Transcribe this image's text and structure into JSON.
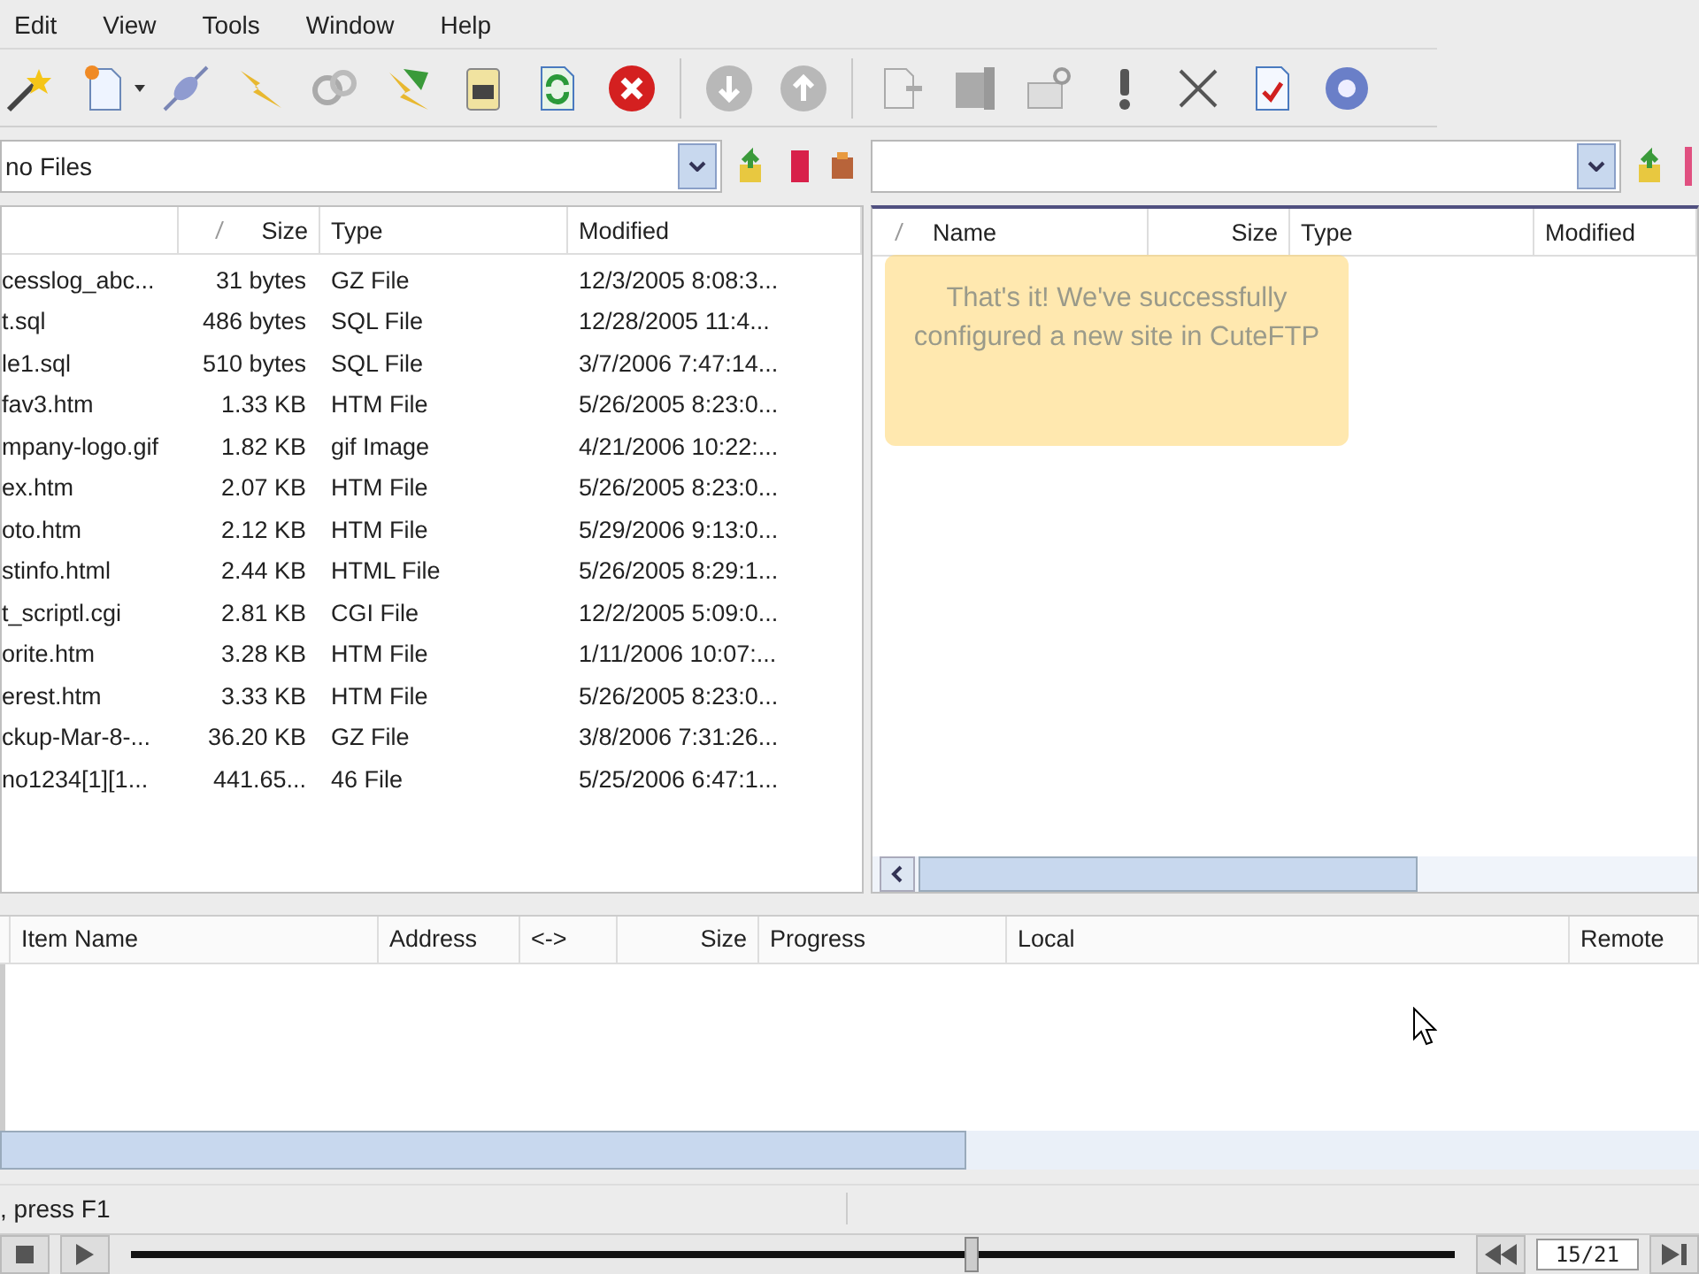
{
  "menu": [
    {
      "label": "Edit"
    },
    {
      "label": "View"
    },
    {
      "label": "Tools"
    },
    {
      "label": "Window"
    },
    {
      "label": "Help"
    }
  ],
  "local_path": {
    "value": "no Files"
  },
  "local_table": {
    "columns": [
      "Size",
      "Type",
      "Modified"
    ],
    "rows": [
      {
        "name": "cesslog_abc...",
        "size": "31 bytes",
        "type": "GZ File",
        "modified": "12/3/2005 8:08:3..."
      },
      {
        "name": "t.sql",
        "size": "486 bytes",
        "type": "SQL File",
        "modified": "12/28/2005 11:4..."
      },
      {
        "name": "le1.sql",
        "size": "510 bytes",
        "type": "SQL File",
        "modified": "3/7/2006 7:47:14..."
      },
      {
        "name": "fav3.htm",
        "size": "1.33 KB",
        "type": "HTM File",
        "modified": "5/26/2005 8:23:0..."
      },
      {
        "name": "mpany-logo.gif",
        "size": "1.82 KB",
        "type": "gif Image",
        "modified": "4/21/2006 10:22:..."
      },
      {
        "name": "ex.htm",
        "size": "2.07 KB",
        "type": "HTM File",
        "modified": "5/26/2005 8:23:0..."
      },
      {
        "name": "oto.htm",
        "size": "2.12 KB",
        "type": "HTM File",
        "modified": "5/29/2006 9:13:0..."
      },
      {
        "name": "stinfo.html",
        "size": "2.44 KB",
        "type": "HTML File",
        "modified": "5/26/2005 8:29:1..."
      },
      {
        "name": "t_scriptl.cgi",
        "size": "2.81 KB",
        "type": "CGI File",
        "modified": "12/2/2005 5:09:0..."
      },
      {
        "name": "orite.htm",
        "size": "3.28 KB",
        "type": "HTM File",
        "modified": "1/11/2006 10:07:..."
      },
      {
        "name": "erest.htm",
        "size": "3.33 KB",
        "type": "HTM File",
        "modified": "5/26/2005 8:23:0..."
      },
      {
        "name": "ckup-Mar-8-...",
        "size": "36.20 KB",
        "type": "GZ File",
        "modified": "3/8/2006 7:31:26..."
      },
      {
        "name": "no1234[1][1...",
        "size": "441.65...",
        "type": "46 File",
        "modified": "5/25/2006 6:47:1..."
      }
    ]
  },
  "remote_table": {
    "columns": [
      "Name",
      "Size",
      "Type",
      "Modified"
    ]
  },
  "tooltip": "That's it! We've successfully configured a new site in CuteFTP",
  "queue": {
    "columns": [
      "Item Name",
      "Address",
      "<->",
      "Size",
      "Progress",
      "Local",
      "Remote"
    ]
  },
  "status_bar": {
    "text": ", press F1"
  },
  "player": {
    "level": 0.635,
    "counter": "15/21"
  }
}
